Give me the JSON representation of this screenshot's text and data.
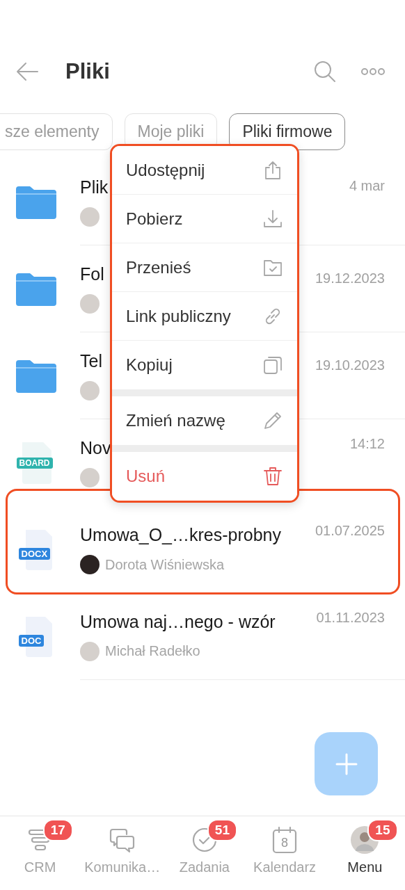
{
  "header": {
    "title": "Pliki"
  },
  "filters": [
    {
      "label": "sze elementy",
      "selected": false
    },
    {
      "label": "Moje pliki",
      "selected": false
    },
    {
      "label": "Pliki firmowe",
      "selected": true
    }
  ],
  "files": [
    {
      "kind": "folder",
      "name": "Plik",
      "date": "4 mar",
      "color": "#d5d0cc",
      "highlighted": false
    },
    {
      "kind": "folder",
      "name": "Fol",
      "date": "19.12.2023",
      "color": "#d5d0cc",
      "highlighted": false
    },
    {
      "kind": "folder",
      "name": "Tel",
      "date": "19.10.2023",
      "color": "#d5d0cc",
      "highlighted": false
    },
    {
      "kind": "board",
      "badge": "BOARD",
      "name": "Nov",
      "date": "14:12",
      "color": "#d5d0cc",
      "highlighted": false
    },
    {
      "kind": "document",
      "badge": "DOCX",
      "name": "Umowa_O_…kres-probny",
      "date": "01.07.2025",
      "color": "#2b2322",
      "owner": "Dorota Wiśniewska",
      "highlighted": true
    },
    {
      "kind": "document",
      "badge": "DOC",
      "name": "Umowa naj…nego - wzór",
      "date": "01.11.2023",
      "color": "#d5d0cc",
      "owner": "Michał Radełko",
      "highlighted": false
    }
  ],
  "context_menu": {
    "groups": [
      [
        {
          "label": "Udostępnij",
          "kind": "normal"
        },
        {
          "label": "Pobierz",
          "kind": "normal"
        },
        {
          "label": "Przenieś",
          "kind": "normal"
        },
        {
          "label": "Link publiczny",
          "kind": "normal"
        },
        {
          "label": "Kopiuj",
          "kind": "normal"
        }
      ],
      [
        {
          "label": "Zmień nazwę",
          "kind": "normal"
        }
      ],
      [
        {
          "label": "Usuń",
          "kind": "danger"
        }
      ]
    ]
  },
  "bottom_nav": [
    {
      "label": "CRM",
      "badge": "17",
      "selected": false
    },
    {
      "label": "Komunika…",
      "selected": false
    },
    {
      "label": "Zadania",
      "badge": "51",
      "selected": false
    },
    {
      "label": "Kalendarz",
      "icon_text": "8",
      "selected": false
    },
    {
      "label": "Menu",
      "badge": "15",
      "selected": true
    }
  ]
}
